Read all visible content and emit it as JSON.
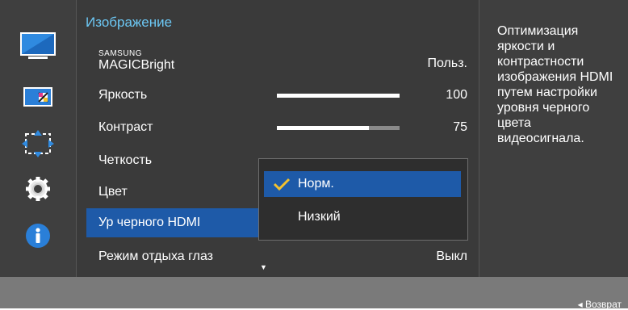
{
  "menu": {
    "title": "Изображение",
    "magic_small": "SAMSUNG",
    "magic_large": "MAGIC",
    "magic_suffix": "Bright",
    "items": [
      {
        "label": "Польз.",
        "value": ""
      },
      {
        "label": "Яркость",
        "value": "100",
        "level": 1.0
      },
      {
        "label": "Контраст",
        "value": "75",
        "level": 0.75
      },
      {
        "label": "Четкость",
        "value": ""
      },
      {
        "label": "Цвет",
        "value": ""
      },
      {
        "label": "Ур черного HDMI",
        "value": ""
      },
      {
        "label": "Режим отдыха глаз",
        "value": "Выкл"
      }
    ],
    "magic_value": "Польз."
  },
  "dropdown": {
    "options": [
      {
        "label": "Норм.",
        "selected": true
      },
      {
        "label": "Низкий",
        "selected": false
      }
    ]
  },
  "help": {
    "text": "Оптимизация яркости и контрастности изображения HDMI путем настройки уровня черного цвета видеосигнала."
  },
  "footer": {
    "back_label": "◂ Возврат"
  },
  "icons": [
    "monitor-icon",
    "picture-size-icon",
    "position-icon",
    "settings-icon",
    "info-icon"
  ],
  "colors": {
    "accent_blue": "#1e5aa8",
    "title_blue": "#6cc8f5",
    "info_blue": "#2a7fd8"
  }
}
